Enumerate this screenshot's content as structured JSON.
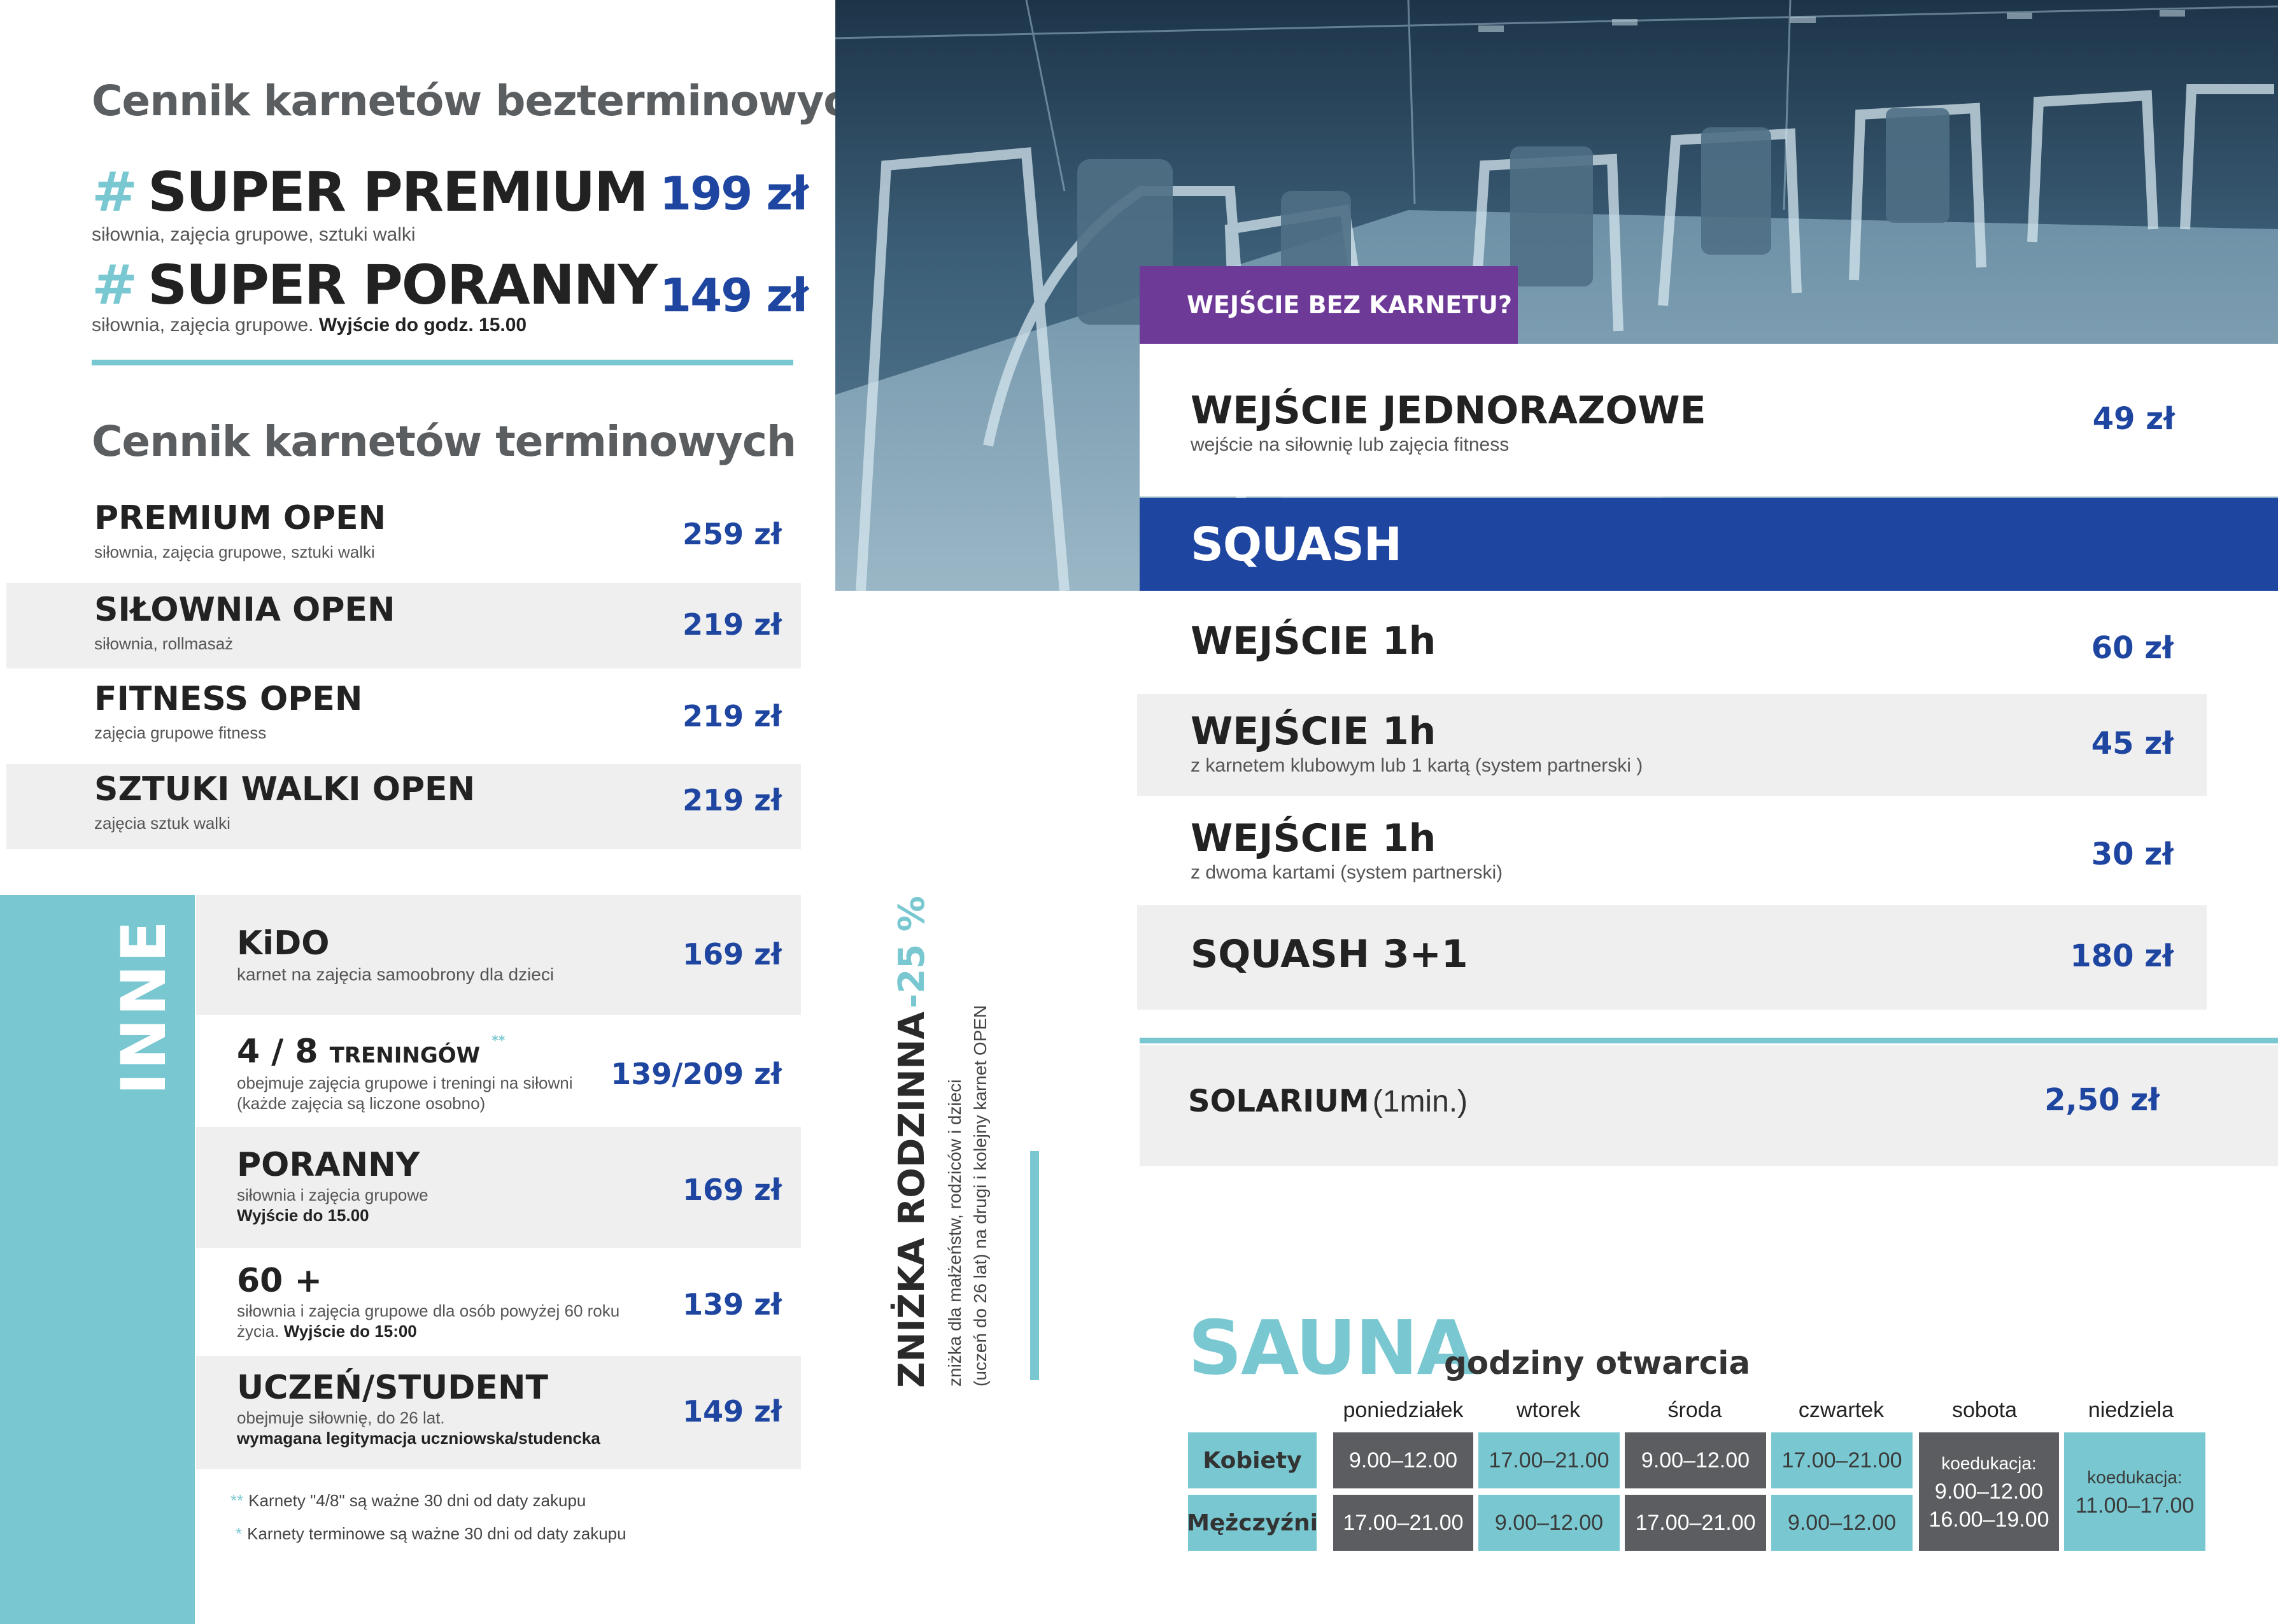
{
  "left": {
    "heading_bezterminowe": "Cennik karnetów bezterminowych",
    "super": [
      {
        "hash": "#",
        "name": "SUPER PREMIUM",
        "desc": "siłownia, zajęcia grupowe, sztuki walki",
        "desc_bold": "",
        "price": "199 zł"
      },
      {
        "hash": "#",
        "name": "SUPER PORANNY",
        "desc": "siłownia, zajęcia grupowe.",
        "desc_bold": "Wyjście do godz. 15.00",
        "price": "149 zł"
      }
    ],
    "heading_terminowe": "Cennik karnetów terminowych",
    "terminowe": [
      {
        "name": "PREMIUM OPEN",
        "desc": "siłownia, zajęcia grupowe, sztuki walki",
        "price": "259 zł"
      },
      {
        "name": "SIŁOWNIA OPEN",
        "desc": "siłownia, rollmasaż",
        "price": "219 zł"
      },
      {
        "name": "FITNESS OPEN",
        "desc": "zajęcia grupowe fitness",
        "price": "219 zł"
      },
      {
        "name": "SZTUKI WALKI OPEN",
        "desc": "zajęcia sztuk walki",
        "price": "219 zł"
      }
    ],
    "inne_label": "INNE",
    "inne": [
      {
        "name": "KiDO",
        "desc1": "karnet na zajęcia samoobrony dla dzieci",
        "desc2": "",
        "price": "169 zł"
      },
      {
        "name": "4 / 8",
        "name_small": "TRENINGÓW",
        "mark": "**",
        "desc1": "obejmuje zajęcia grupowe i treningi na siłowni",
        "desc2": "(każde zajęcia są liczone osobno)",
        "price": "139/209 zł"
      },
      {
        "name": "PORANNY",
        "desc1": "siłownia i zajęcia grupowe",
        "desc2": "Wyjście do 15.00",
        "price": "169 zł"
      },
      {
        "name": "60 +",
        "desc1": "siłownia i zajęcia grupowe dla osób powyżej 60 roku",
        "desc2_plain": "życia.",
        "desc2": "Wyjście do 15:00",
        "price": "139 zł"
      },
      {
        "name": "UCZEŃ/STUDENT",
        "desc1": "obejmuje siłownię, do 26 lat.",
        "desc2": "wymagana legitymacja uczniowska/studencka",
        "price": "149 zł"
      }
    ],
    "notes": [
      {
        "mark": "**",
        "text": "Karnety \"4/8\" są ważne 30 dni od daty zakupu"
      },
      {
        "mark": "*",
        "text": "Karnety terminowe są ważne 30 dni od daty zakupu"
      }
    ]
  },
  "discount": {
    "title": "ZNIŻKA RODZINNA",
    "percent": "-25 %",
    "line1": "zniżka dla małżeństw, rodziców i dzieci",
    "line2": "(uczeń do 26 lat) na drugi i kolejny karnet OPEN"
  },
  "right": {
    "tag": "WEJŚCIE BEZ KARNETU?",
    "single": {
      "name": "WEJŚCIE JEDNORAZOWE",
      "desc": "wejście na siłownię lub zajęcia fitness",
      "price": "49 zł"
    },
    "squash_heading": "SQUASH",
    "squash": [
      {
        "name": "WEJŚCIE 1h",
        "desc": "",
        "price": "60 zł"
      },
      {
        "name": "WEJŚCIE 1h",
        "desc": "z karnetem klubowym lub 1 kartą (system partnerski )",
        "price": "45 zł"
      },
      {
        "name": "WEJŚCIE 1h",
        "desc": "z dwoma kartami (system partnerski)",
        "price": "30 zł"
      },
      {
        "name": "SQUASH 3+1",
        "desc": "",
        "price": "180 zł"
      }
    ],
    "solarium": {
      "name": "SOLARIUM",
      "unit": "(1min.)",
      "price": "2,50 zł"
    }
  },
  "sauna": {
    "title": "SAUNA",
    "subtitle": "godziny otwarcia",
    "days": [
      "poniedziałek",
      "wtorek",
      "środa",
      "czwartek",
      "sobota",
      "niedziela"
    ],
    "rows": [
      {
        "label": "Kobiety",
        "cells": [
          "9.00–12.00",
          "17.00–21.00",
          "9.00–12.00",
          "17.00–21.00"
        ]
      },
      {
        "label": "Mężczyźni",
        "cells": [
          "17.00–21.00",
          "9.00–12.00",
          "17.00–21.00",
          "9.00–12.00"
        ]
      }
    ],
    "saturday": {
      "label": "koedukacja:",
      "line1": "9.00–12.00",
      "line2": "16.00–19.00"
    },
    "sunday": {
      "label": "koedukacja:",
      "line1": "11.00–17.00"
    }
  },
  "colors": {
    "blue": "#1e45a0",
    "teal": "#79c8d1",
    "purple": "#6d3a98",
    "dark_grey": "#5b5d60",
    "light_grey": "#efeff0"
  }
}
